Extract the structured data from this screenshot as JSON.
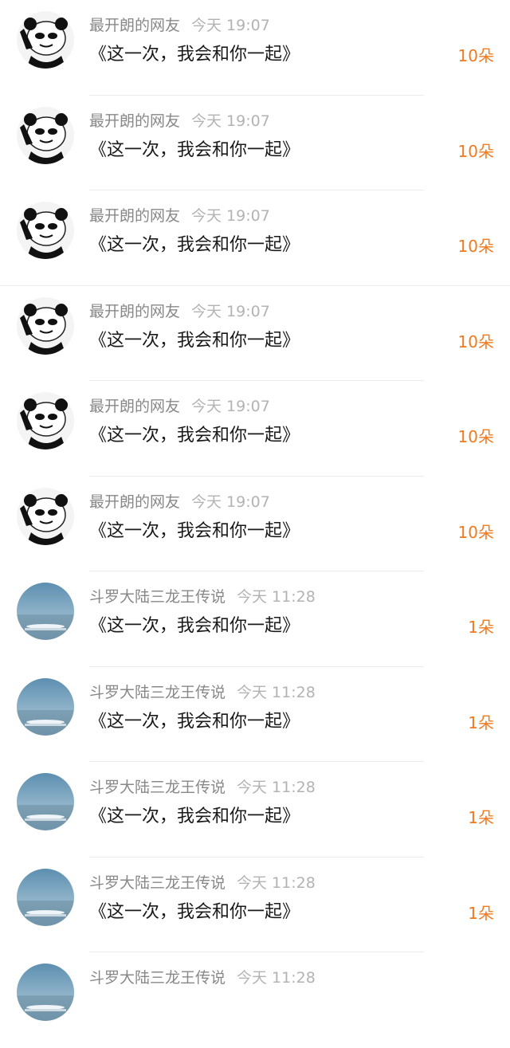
{
  "gifts": [
    {
      "avatar": "panda-meme-icon",
      "name": "最开朗的网友",
      "time": "今天 19:07",
      "title": "《这一次，我会和你一起》",
      "count": "10朵"
    },
    {
      "avatar": "panda-meme-icon",
      "name": "最开朗的网友",
      "time": "今天 19:07",
      "title": "《这一次，我会和你一起》",
      "count": "10朵"
    },
    {
      "avatar": "panda-meme-icon",
      "name": "最开朗的网友",
      "time": "今天 19:07",
      "title": "《这一次，我会和你一起》",
      "count": "10朵"
    },
    {
      "avatar": "panda-meme-icon",
      "name": "最开朗的网友",
      "time": "今天 19:07",
      "title": "《这一次，我会和你一起》",
      "count": "10朵"
    },
    {
      "avatar": "panda-meme-icon",
      "name": "最开朗的网友",
      "time": "今天 19:07",
      "title": "《这一次，我会和你一起》",
      "count": "10朵"
    },
    {
      "avatar": "panda-meme-icon",
      "name": "最开朗的网友",
      "time": "今天 19:07",
      "title": "《这一次，我会和你一起》",
      "count": "10朵"
    },
    {
      "avatar": "sky-sea-avatar-icon",
      "name": "斗罗大陆三龙王传说",
      "time": "今天 11:28",
      "title": "《这一次，我会和你一起》",
      "count": "1朵"
    },
    {
      "avatar": "sky-sea-avatar-icon",
      "name": "斗罗大陆三龙王传说",
      "time": "今天 11:28",
      "title": "《这一次，我会和你一起》",
      "count": "1朵"
    },
    {
      "avatar": "sky-sea-avatar-icon",
      "name": "斗罗大陆三龙王传说",
      "time": "今天 11:28",
      "title": "《这一次，我会和你一起》",
      "count": "1朵"
    },
    {
      "avatar": "sky-sea-avatar-icon",
      "name": "斗罗大陆三龙王传说",
      "time": "今天 11:28",
      "title": "《这一次，我会和你一起》",
      "count": "1朵"
    },
    {
      "avatar": "sky-sea-avatar-icon",
      "name": "斗罗大陆三龙王传说",
      "time": "今天 11:28",
      "title": "",
      "count": ""
    }
  ],
  "colors": {
    "name": "#888888",
    "time": "#b3b3b3",
    "title": "#1a1a1a",
    "count": "#f07a1f",
    "divider": "#ececec"
  }
}
